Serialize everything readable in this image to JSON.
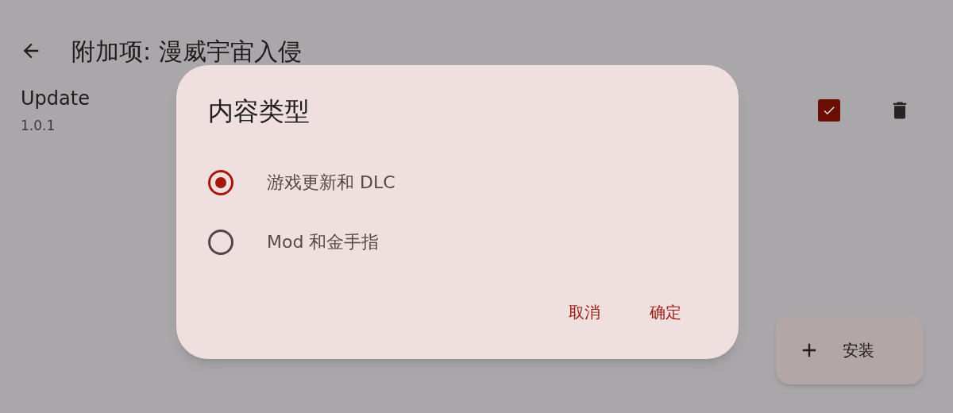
{
  "app_bar": {
    "title": "附加项: 漫威宇宙入侵"
  },
  "items": [
    {
      "name": "Update",
      "version": "1.0.1",
      "checked": true
    }
  ],
  "fab": {
    "label": "安装"
  },
  "dialog": {
    "title": "内容类型",
    "options": [
      {
        "label": "游戏更新和 DLC",
        "selected": true
      },
      {
        "label": "Mod 和金手指",
        "selected": false
      }
    ],
    "buttons": [
      "取消",
      "确定"
    ]
  }
}
